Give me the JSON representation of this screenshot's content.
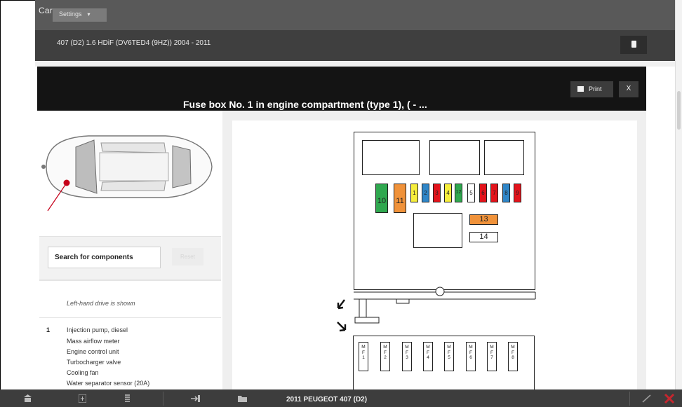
{
  "topbar": {
    "cars_tab": "Cars",
    "settings_label": "Settings",
    "settings_caret": "▾"
  },
  "vehicle": {
    "title": "407 (D2) 1.6 HDiF (DV6TED4 (9HZ)) 2004 - 2011",
    "doc_icon": "document-icon"
  },
  "modal": {
    "title": "Fuse box No. 1 in engine compartment (type 1), ( - ...",
    "print_label": "Print",
    "close_label": "X"
  },
  "left": {
    "search_placeholder": "Search for components",
    "reset_label": "Reset",
    "lhd_note": "Left-hand drive is shown",
    "item_number": "1",
    "components": [
      "Injection pump, diesel",
      "Mass airflow meter",
      "Engine control unit",
      "Turbocharger valve",
      "Cooling fan",
      "Water separator sensor (20A)"
    ]
  },
  "fuses": {
    "large": [
      "10",
      "11"
    ],
    "small": [
      "1",
      "2",
      "3",
      "4",
      "12",
      "5",
      "6",
      "7",
      "8",
      "9"
    ],
    "mid": [
      "13",
      "14"
    ],
    "mf": [
      [
        "M",
        "F",
        "1"
      ],
      [
        "M",
        "F",
        "2"
      ],
      [
        "M",
        "F",
        "3"
      ],
      [
        "M",
        "F",
        "4"
      ],
      [
        "M",
        "F",
        "5"
      ],
      [
        "M",
        "F",
        "6"
      ],
      [
        "M",
        "F",
        "7"
      ],
      [
        "M",
        "F",
        "8"
      ]
    ]
  },
  "colors": {
    "green": "#2fa84f",
    "orange": "#f0923a",
    "yellow": "#f6ee3c",
    "blue": "#2f86c8",
    "red": "#e3131b"
  },
  "bottombar": {
    "title": "2011 PEUGEOT 407 (D2)"
  }
}
